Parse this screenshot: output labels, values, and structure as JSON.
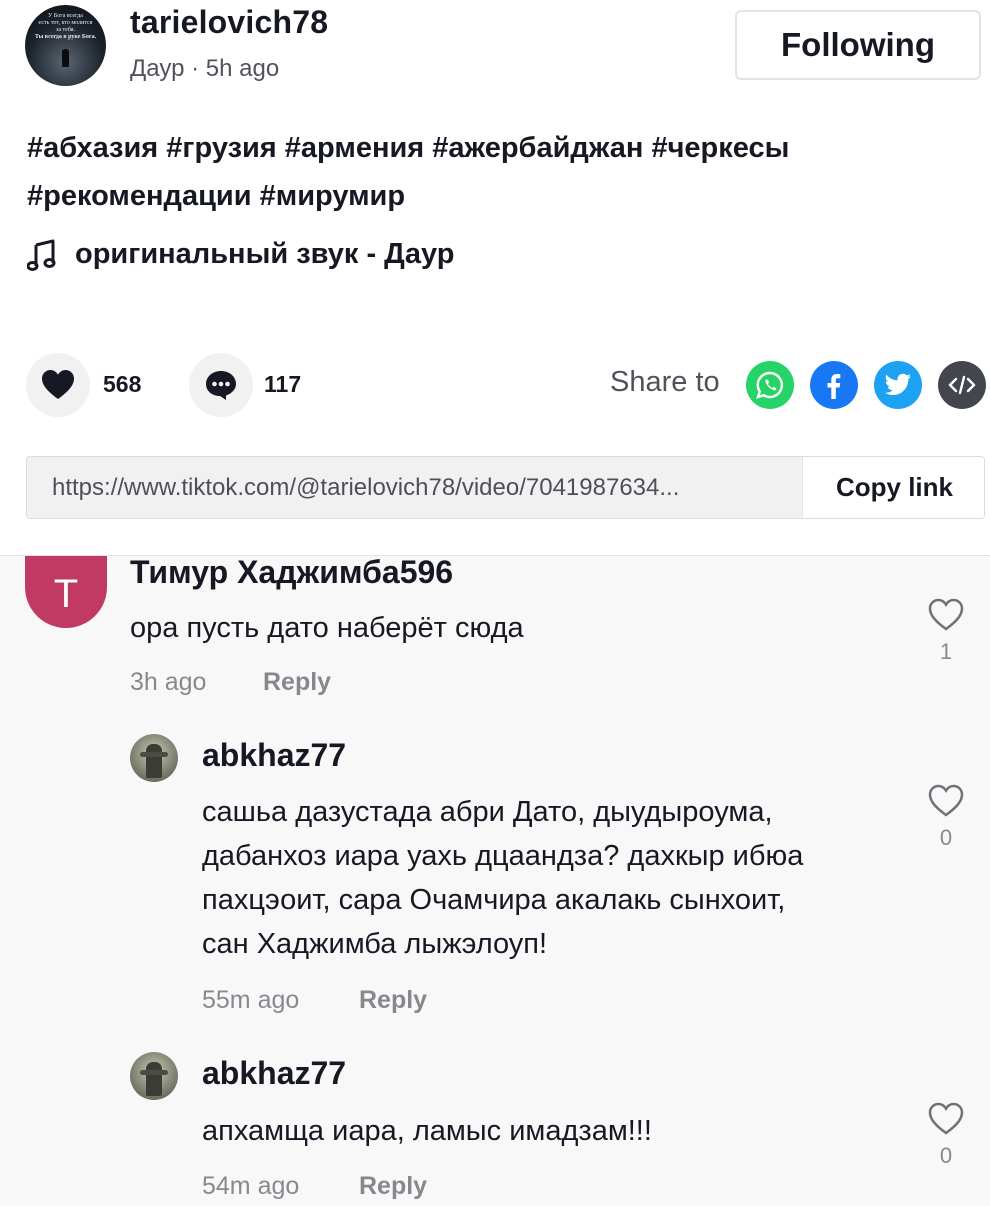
{
  "post": {
    "author_username": "tarielovich78",
    "author_display": "Даур",
    "time_ago": "5h ago",
    "avatar_caption": "У Бога всегда есть тот, кто молится за тебя. Ты всегда в руке Бога.",
    "follow_label": "Following",
    "caption_line1": "#абхазия #грузия #армения #ажербайджан #черкесы",
    "caption_line2": "#рекомендации #мирумир",
    "music_label": "оригинальный звук - Даур",
    "music_icon": "music-note-icon"
  },
  "actions": {
    "like_count": "568",
    "comment_count": "117",
    "share_label": "Share to",
    "like_icon": "heart-icon",
    "comment_icon": "comment-bubble-icon",
    "share_targets": [
      {
        "name": "whatsapp",
        "icon": "whatsapp-icon",
        "color": "#25D366"
      },
      {
        "name": "facebook",
        "icon": "facebook-icon",
        "color": "#1877F2"
      },
      {
        "name": "twitter",
        "icon": "twitter-icon",
        "color": "#1DA1F2"
      },
      {
        "name": "embed",
        "icon": "embed-code-icon",
        "color": "#161823"
      }
    ]
  },
  "link": {
    "url": "https://www.tiktok.com/@tarielovich78/video/7041987634...",
    "copy_label": "Copy link"
  },
  "comments": [
    {
      "avatar_letter": "T",
      "avatar_color": "#C13A63",
      "name": "Тимур Хаджимба596",
      "text": "ора пусть дато наберёт сюда",
      "time": "3h ago",
      "reply_label": "Reply",
      "likes": "1",
      "replies": [
        {
          "name": "abkhaz77",
          "text_lines": [
            "сашьа дазустада абри Дато, дыудыроума,",
            "дабанхоз иара уахь дцаандза? дахкыр ибюа",
            "пахцэоит, сара Очамчира акалакь сынхоит,",
            "сан Хаджимба лыжэлоуп!"
          ],
          "time": "55m ago",
          "reply_label": "Reply",
          "likes": "0"
        },
        {
          "name": "abkhaz77",
          "text_lines": [
            "апхамща иара, ламыс имадзам!!!"
          ],
          "time": "54m ago",
          "reply_label": "Reply",
          "likes": "0"
        }
      ]
    }
  ]
}
